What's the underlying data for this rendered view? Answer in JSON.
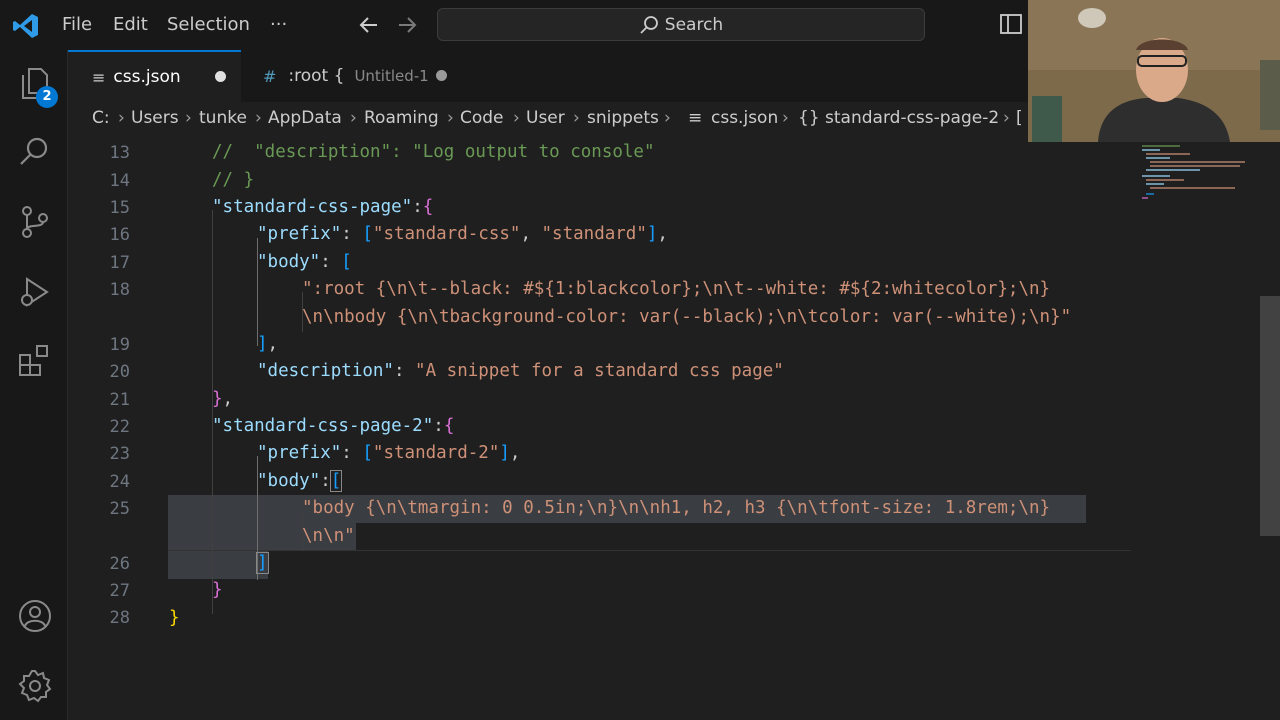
{
  "menu": {
    "file": "File",
    "edit": "Edit",
    "selection": "Selection",
    "more": "···"
  },
  "search": {
    "label": "Search"
  },
  "activity": {
    "source_control_badge": "2"
  },
  "tabs": [
    {
      "icon": "≡",
      "label": "css.json",
      "dirty": true
    },
    {
      "icon": "#",
      "label": ":root {",
      "sublabel": "Untitled-1",
      "dirty": true
    }
  ],
  "breadcrumb": [
    "C:",
    "Users",
    "tunke",
    "AppData",
    "Roaming",
    "Code",
    "User",
    "snippets",
    "css.json",
    "{} standard-css-page-2",
    "["
  ],
  "editor": {
    "line_numbers": [
      "13",
      "14",
      "15",
      "16",
      "17",
      "18",
      "19",
      "20",
      "21",
      "22",
      "23",
      "24",
      "25",
      "26",
      "27",
      "28"
    ],
    "lines": {
      "l13": "//  \"description\": \"Log output to console\"",
      "l14": "// }",
      "l15_key": "\"standard-css-page\"",
      "l15_rest": ":",
      "l15_brace": "{",
      "l16_key": "\"prefix\"",
      "l16_colon": ": ",
      "l16_open": "[",
      "l16_v1": "\"standard-css\"",
      "l16_comma": ", ",
      "l16_v2": "\"standard\"",
      "l16_close": "]",
      "l16_end": ",",
      "l17_key": "\"body\"",
      "l17_colon": ": ",
      "l17_open": "[",
      "l18a": "\":root {\\n\\t--black: #${1:blackcolor};\\n\\t--white: #${2:whitecolor};\\n}",
      "l18b": "\\n\\nbody {\\n\\tbackground-color: var(--black);\\n\\tcolor: var(--white);\\n}\"",
      "l19_close": "]",
      "l19_end": ",",
      "l20_key": "\"description\"",
      "l20_colon": ": ",
      "l20_val": "\"A snippet for a standard css page\"",
      "l21_close": "}",
      "l21_end": ",",
      "l22_key": "\"standard-css-page-2\"",
      "l22_rest": ":",
      "l22_brace": "{",
      "l23_key": "\"prefix\"",
      "l23_colon": ": ",
      "l23_open": "[",
      "l23_val": "\"standard-2\"",
      "l23_close": "]",
      "l23_end": ",",
      "l24_key": "\"body\"",
      "l24_colon": ":",
      "l24_open": "[",
      "l25a": "\"body {\\n\\tmargin: 0 0.5in;\\n}\\n\\nh1, h2, h3 {\\n\\tfont-size: 1.8rem;\\n}",
      "l25b": "\\n\\n\"",
      "l26_close": "]",
      "l27_close": "}",
      "l28_close": "}"
    }
  },
  "colors": {
    "accent": "#0078d4",
    "string": "#ce9178",
    "key": "#9cdcfe",
    "comment": "#6a9955"
  }
}
